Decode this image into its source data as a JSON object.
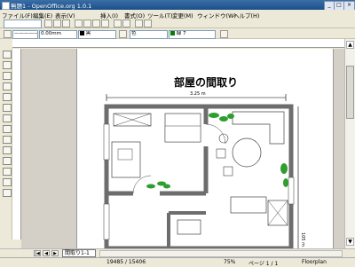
{
  "window": {
    "title": "無題1 - OpenOffice.org 1.0.1"
  },
  "menu": [
    "ファイル(F)",
    "編集(E)",
    "表示(V)",
    "挿入(I)",
    "書式(O)",
    "ツール(T)",
    "変更(M)",
    "ウィンドウ(W)",
    "ヘルプ(H)"
  ],
  "linebar": {
    "width_value": "0.00mm",
    "line_color": "黒",
    "area_type": "色",
    "area_color": "緑 7"
  },
  "drawing": {
    "title": "部屋の間取り",
    "dim_top": "3.25 m",
    "dim_right": "105 m"
  },
  "tabs": {
    "active": "間取り1-1"
  },
  "status": {
    "coords": "19485 / 15406",
    "zoom": "75%",
    "page": "ページ 1 / 1",
    "layout": "Floorplan"
  },
  "colors": {
    "titlebar": "#1c4f8a",
    "wall": "#6d6d6d",
    "plant": "#2e9e2e",
    "accent_green": "#0a7a0a"
  }
}
